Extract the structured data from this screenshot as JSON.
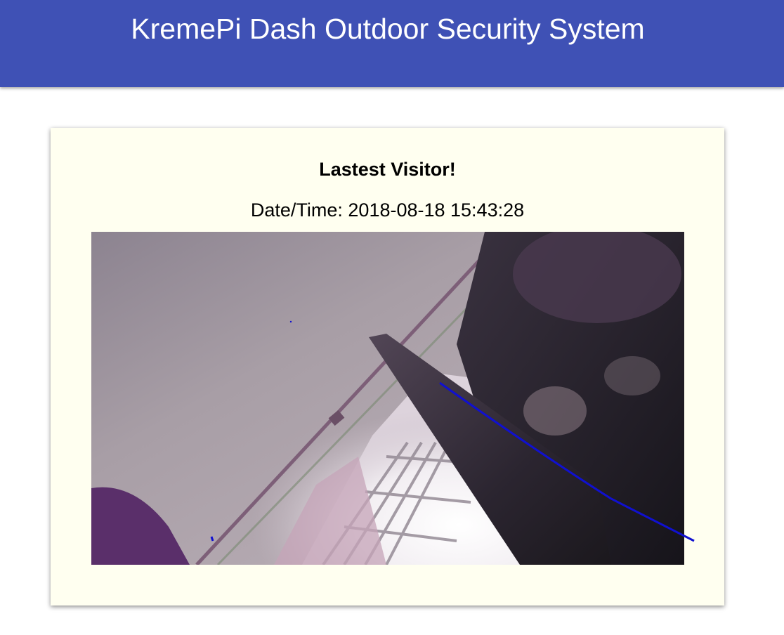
{
  "header": {
    "title": "KremePi Dash Outdoor Security System",
    "background_color": "#3f51b5"
  },
  "visitor_card": {
    "heading": "Lastest Visitor!",
    "datetime_label": "Date/Time: 2018-08-18 15:43:28",
    "background_color": "#fffff0"
  },
  "snapshot": {
    "alt": "Visitor snapshot"
  }
}
